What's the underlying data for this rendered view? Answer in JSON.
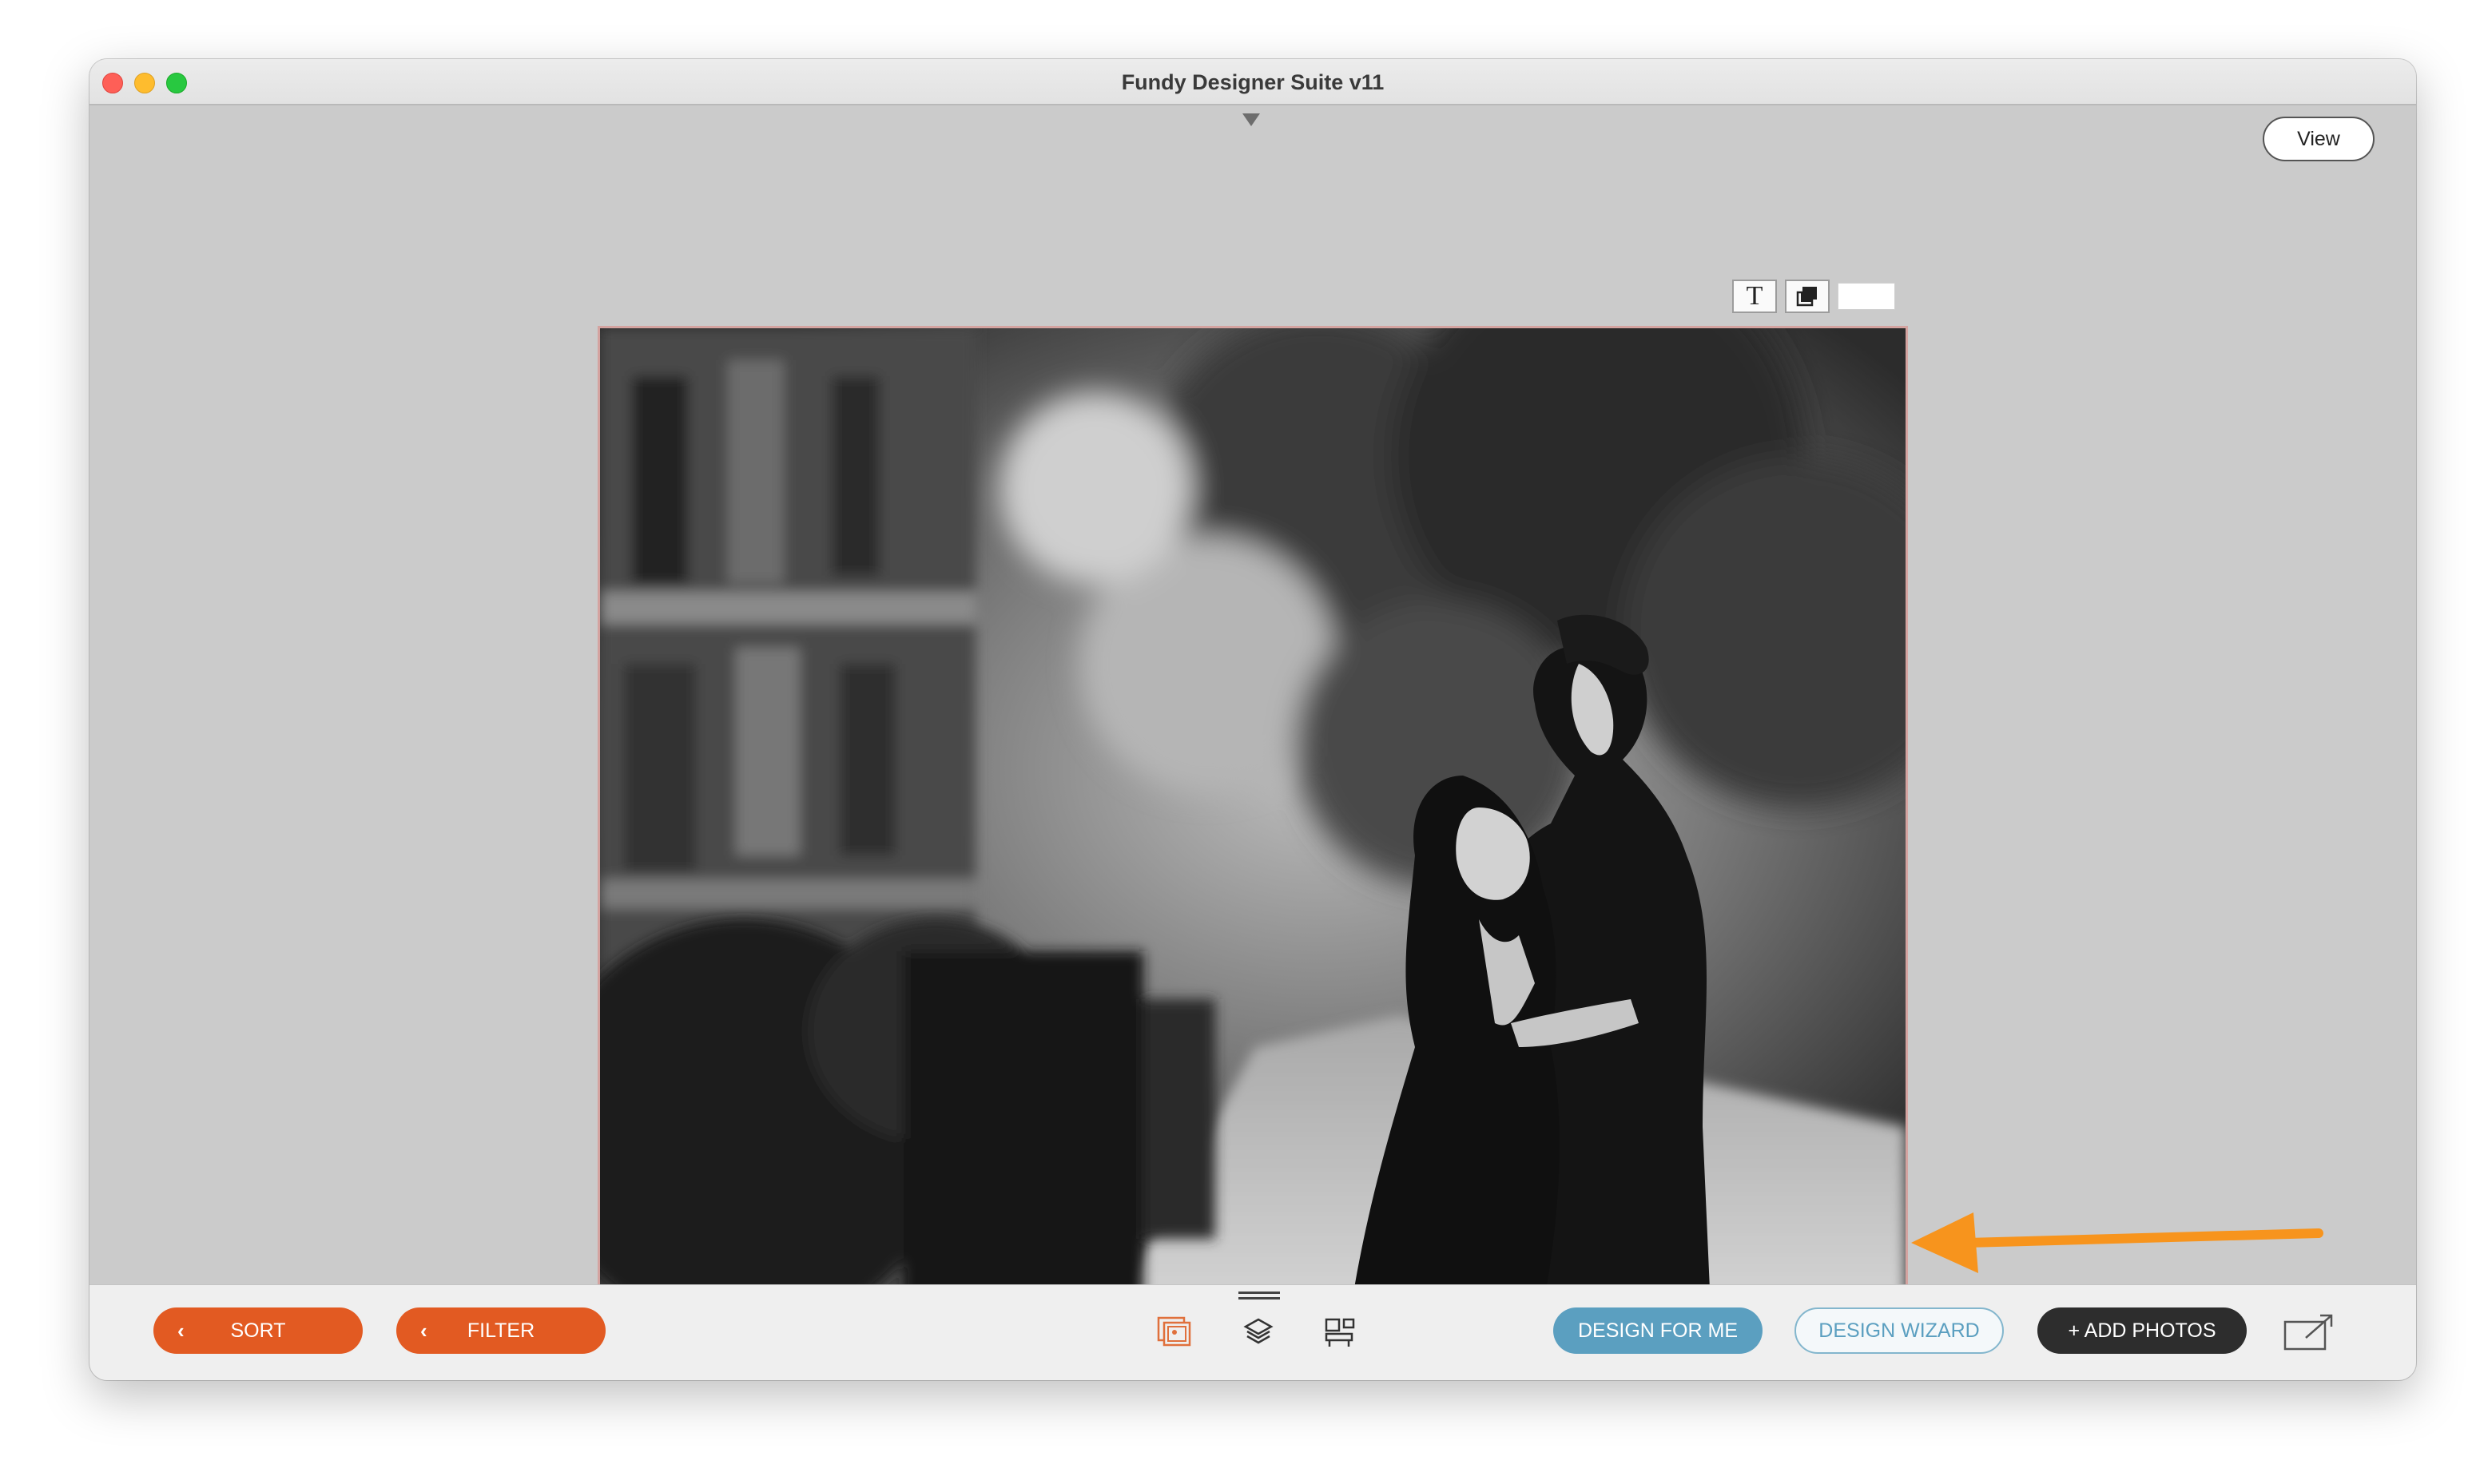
{
  "window": {
    "title": "Fundy Designer Suite v11"
  },
  "header": {
    "view_label": "View"
  },
  "frame_tools": {
    "text_tool_glyph": "T",
    "icons": [
      "text-tool-icon",
      "arrange-layers-icon",
      "color-swatch"
    ]
  },
  "photo": {
    "description_icon": "photo-couple-black-and-white"
  },
  "annotation": {
    "arrow_color": "#f7941d"
  },
  "toolbar": {
    "sort_label": "SORT",
    "filter_label": "FILTER",
    "chevron": "‹",
    "design_for_me_label": "DESIGN FOR ME",
    "design_wizard_label": "DESIGN WIZARD",
    "add_photos_label": "+ ADD PHOTOS",
    "center_icons": [
      "images-icon",
      "layers-icon",
      "layout-tools-icon"
    ],
    "export_icon": "export-icon"
  },
  "colors": {
    "accent_orange": "#e25a22",
    "accent_blue": "#5b9fc0",
    "dark_button": "#2d2d2d",
    "canvas_bg": "#cbcbcb"
  }
}
